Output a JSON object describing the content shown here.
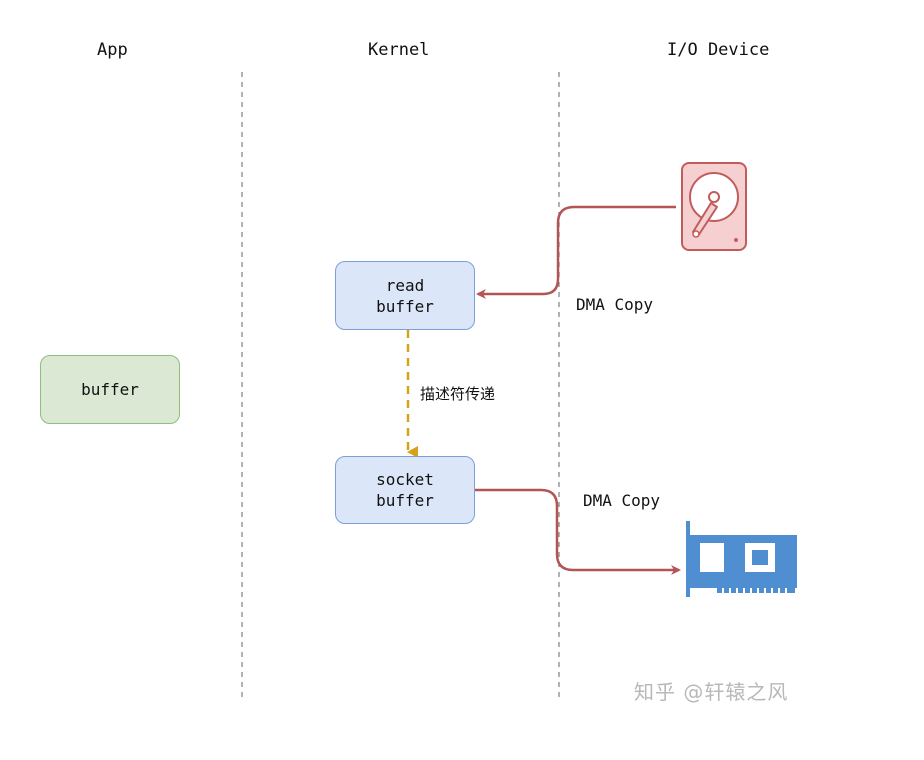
{
  "columns": {
    "app": "App",
    "kernel": "Kernel",
    "io_device": "I/O Device"
  },
  "app_buffer": {
    "label": "buffer"
  },
  "read_buffer": {
    "line1": "read",
    "line2": "buffer"
  },
  "socket_buffer": {
    "line1": "socket",
    "line2": "buffer"
  },
  "edges": {
    "disk_to_read": "DMA Copy",
    "read_to_socket": "描述符传递",
    "socket_to_nic": "DMA Copy"
  },
  "icons": {
    "disk": "hard-disk-icon",
    "nic": "network-card-icon"
  },
  "colors": {
    "dma_arrow": "#b35555",
    "descriptor_arrow": "#d6a21a",
    "disk_fill": "#f6d0d0",
    "nic_fill": "#4f8fd1"
  },
  "watermark": "知乎 @轩辕之风"
}
